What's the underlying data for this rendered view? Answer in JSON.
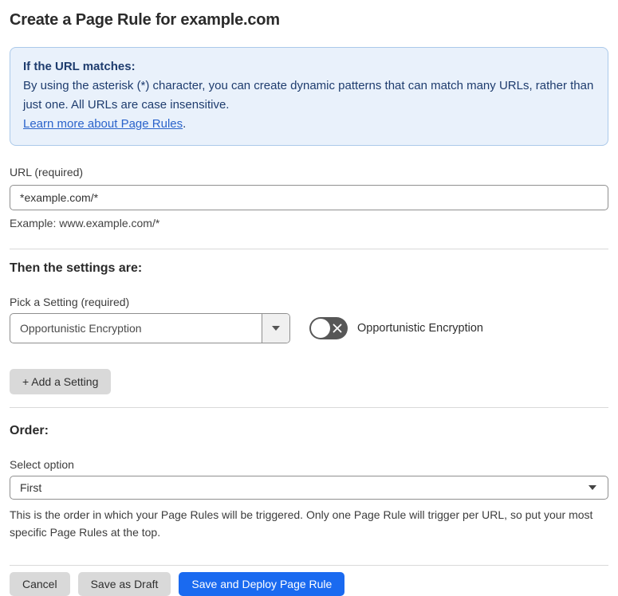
{
  "page": {
    "title": "Create a Page Rule for example.com"
  },
  "info_box": {
    "heading": "If the URL matches:",
    "body": "By using the asterisk (*) character, you can create dynamic patterns that can match many URLs, rather than just one. All URLs are case insensitive.",
    "link_label": "Learn more about Page Rules",
    "link_suffix": "."
  },
  "url_field": {
    "label": "URL (required)",
    "value": "*example.com/*",
    "helper": "Example: www.example.com/*"
  },
  "settings_section": {
    "heading": "Then the settings are:",
    "picker_label": "Pick a Setting (required)",
    "selected_setting": "Opportunistic Encryption",
    "toggle_label": "Opportunistic Encryption",
    "toggle_state": "off",
    "add_setting_button": "+ Add a Setting"
  },
  "order_section": {
    "heading": "Order:",
    "select_label": "Select option",
    "selected_option": "First",
    "helper": "This is the order in which your Page Rules will be triggered. Only one Page Rule will trigger per URL, so put your most specific Page Rules at the top."
  },
  "actions": {
    "cancel": "Cancel",
    "save_draft": "Save as Draft",
    "save_deploy": "Save and Deploy Page Rule"
  },
  "colors": {
    "info_bg": "#e9f1fb",
    "info_border": "#abc9ea",
    "info_text": "#1e3c6e",
    "link_blue": "#2a63cb",
    "primary_button_blue": "#1a6af0",
    "gray_button": "#d9d9d9",
    "toggle_off_gray": "#575757"
  }
}
